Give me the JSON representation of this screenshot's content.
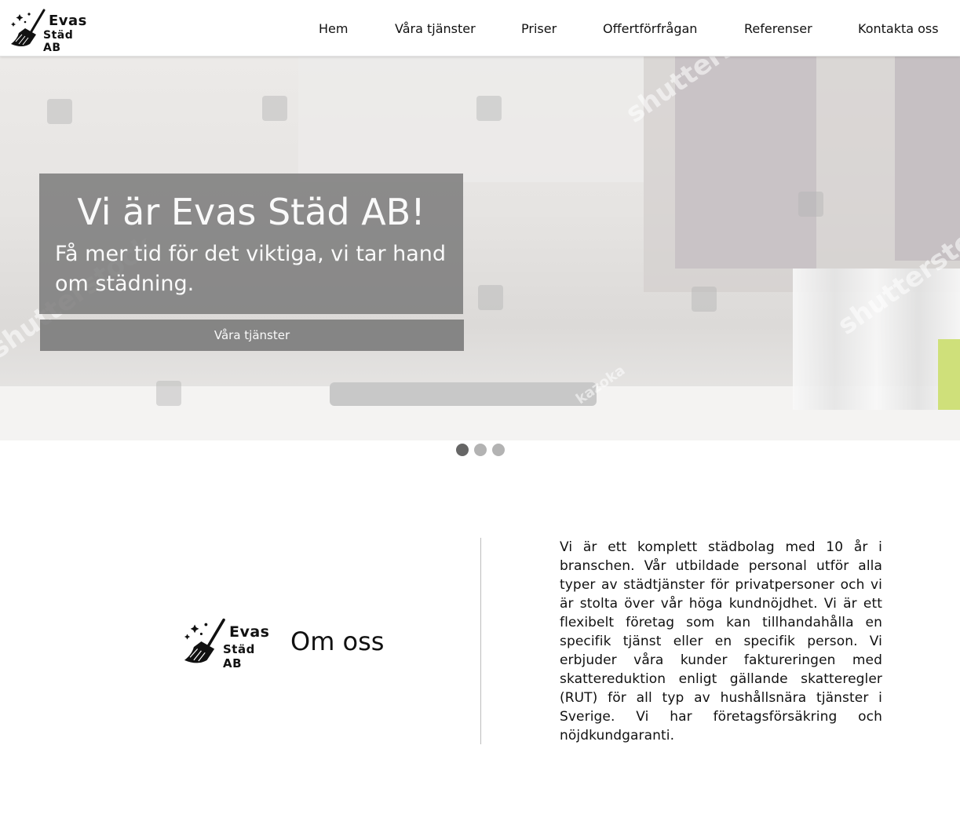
{
  "brand": {
    "line1": "Evas",
    "line2": "Städ AB"
  },
  "nav": {
    "items": [
      {
        "label": "Hem"
      },
      {
        "label": "Våra tjänster"
      },
      {
        "label": "Priser"
      },
      {
        "label": "Offertförfrågan"
      },
      {
        "label": "Referenser"
      },
      {
        "label": "Kontakta oss"
      }
    ]
  },
  "hero": {
    "title": "Vi är Evas Städ AB!",
    "subtitle": "Få mer tid för det viktiga, vi tar hand om städning.",
    "button_label": "Våra tjänster",
    "watermark": "shutterstock",
    "watermark_small": "kazoka"
  },
  "carousel": {
    "slide_count": 3,
    "active_index": 0
  },
  "about": {
    "brand_line1": "Evas",
    "brand_line2": "Städ AB",
    "title": "Om oss",
    "text": "Vi är ett komplett städbolag med 10 år i branschen. Vår utbildade personal utför alla typer av städtjänster för privatpersoner och vi är stolta över vår höga kundnöjdhet. Vi är ett flexibelt företag som kan tillhandahålla en specifik tjänst eller en specifik person. Vi erbjuder våra kunder faktureringen med skattereduktion enligt gällande skatteregler (RUT) för all typ av hushållsnära tjänster i Sverige. Vi har företagsförsäkring och nöjdkundgaranti."
  },
  "colors": {
    "overlay": "#767676",
    "dot_active": "#666666",
    "dot_inactive": "#b3b3b3"
  }
}
